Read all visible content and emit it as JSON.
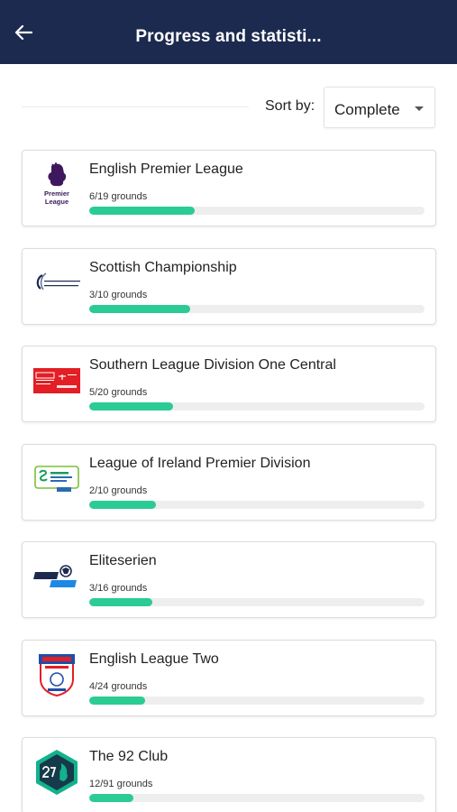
{
  "header": {
    "title": "Progress and statisti..."
  },
  "sort": {
    "label": "Sort by:",
    "value": "Complete"
  },
  "colors": {
    "appbar": "#1c2a4f",
    "progress": "#2bcb94",
    "track": "#eeeeee"
  },
  "leagues": [
    {
      "name": "English Premier League",
      "grounds": "6/19 grounds",
      "done": 6,
      "total": 19,
      "logo": "premier-league-logo-icon"
    },
    {
      "name": "Scottish Championship",
      "grounds": "3/10 grounds",
      "done": 3,
      "total": 10,
      "logo": "scottish-championship-logo-icon"
    },
    {
      "name": "Southern League Division One Central",
      "grounds": "5/20 grounds",
      "done": 5,
      "total": 20,
      "logo": "southern-league-logo-icon"
    },
    {
      "name": "League of Ireland Premier Division",
      "grounds": "2/10 grounds",
      "done": 2,
      "total": 10,
      "logo": "league-of-ireland-logo-icon"
    },
    {
      "name": "Eliteserien",
      "grounds": "3/16 grounds",
      "done": 3,
      "total": 16,
      "logo": "eliteserien-logo-icon"
    },
    {
      "name": "English League Two",
      "grounds": "4/24 grounds",
      "done": 4,
      "total": 24,
      "logo": "efl-league-two-logo-icon"
    },
    {
      "name": "The 92 Club",
      "grounds": "12/91 grounds",
      "done": 12,
      "total": 91,
      "logo": "the-92-club-logo-icon"
    }
  ]
}
